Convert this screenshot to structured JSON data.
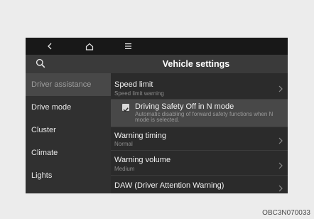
{
  "topbar": {
    "back_icon": "chevron-left-icon",
    "home_icon": "home-icon",
    "menu_icon": "menu-icon"
  },
  "header": {
    "search_icon": "search-icon",
    "title": "Vehicle settings"
  },
  "sidebar": {
    "items": [
      {
        "label": "Driver assistance",
        "selected": true
      },
      {
        "label": "Drive mode",
        "selected": false
      },
      {
        "label": "Cluster",
        "selected": false
      },
      {
        "label": "Climate",
        "selected": false
      },
      {
        "label": "Lights",
        "selected": false
      }
    ]
  },
  "settings": {
    "items": [
      {
        "title": "Speed limit",
        "subtitle": "Speed limit warning"
      },
      {
        "title": "Driving Safety Off in N mode",
        "description": "Automatic disabling of forward safety functions when N mode is selected.",
        "checked": true
      },
      {
        "title": "Warning timing",
        "subtitle": "Normal"
      },
      {
        "title": "Warning volume",
        "subtitle": "Medium"
      },
      {
        "title": "DAW (Driver Attention Warning)"
      }
    ]
  },
  "colors": {
    "screen_bg": "#2b2b2b",
    "topbar_bg": "#181818",
    "header_bg": "#3a3a3a",
    "highlight_bg": "#484848"
  },
  "caption": "OBC3N070033"
}
